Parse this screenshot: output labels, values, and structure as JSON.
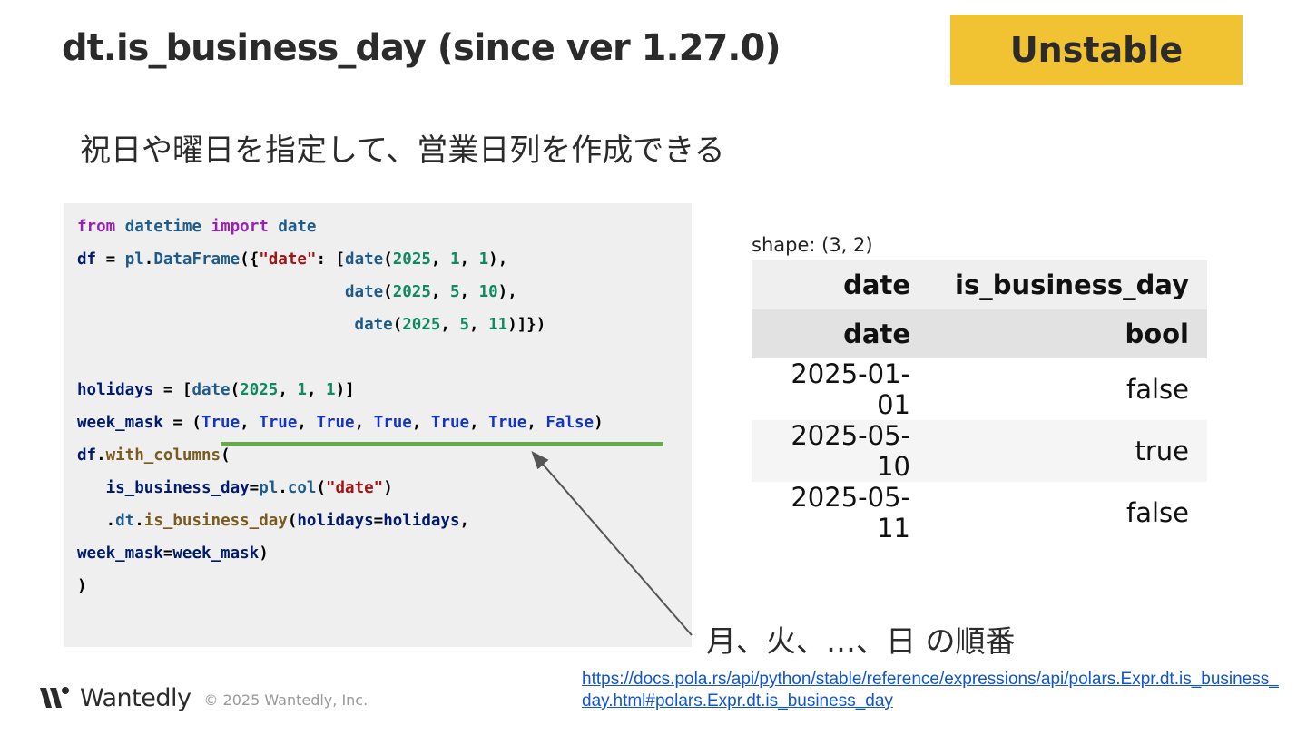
{
  "slide": {
    "title": "dt.is_business_day (since ver 1.27.0)",
    "badge": "Unstable",
    "subtitle": "祝日や曜日を指定して、営業日列を作成できる",
    "note": "月、火、…、日 の順番",
    "link": "https://docs.pola.rs/api/python/stable/reference/expressions/api/polars.Expr.dt.is_business_day.html#polars.Expr.dt.is_business_day"
  },
  "code": {
    "lines": [
      "from datetime import date",
      "df = pl.DataFrame({\"date\": [date(2025, 1, 1),",
      "                            date(2025, 5, 10),",
      "                             date(2025, 5, 11)]})",
      "",
      "holidays = [date(2025, 1, 1)]",
      "week_mask = (True, True, True, True, True, True, False)",
      "df.with_columns(",
      "   is_business_day=pl.col(\"date\")",
      "   .dt.is_business_day(holidays=holidays,",
      "week_mask=week_mask)",
      ")"
    ]
  },
  "output": {
    "shape_label": "shape: (3, 2)",
    "columns": [
      "date",
      "is_business_day"
    ],
    "dtypes": [
      "date",
      "bool"
    ],
    "rows": [
      [
        "2025-01-01",
        "false"
      ],
      [
        "2025-05-10",
        "true"
      ],
      [
        "2025-05-11",
        "false"
      ]
    ]
  },
  "footer": {
    "brand": "Wantedly",
    "copyright": "© 2025 Wantedly, Inc."
  },
  "colors": {
    "badge": "#f1c232",
    "code_background": "#efefef",
    "underline": "#6aa84f",
    "link": "#1155cc"
  }
}
